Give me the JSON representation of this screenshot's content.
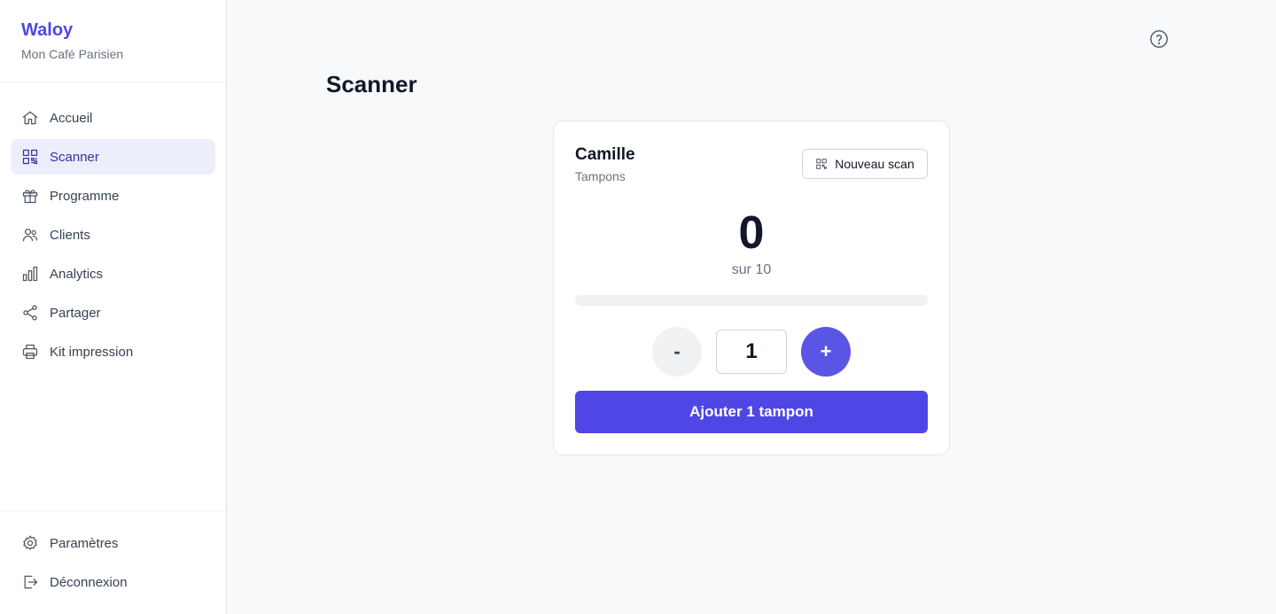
{
  "brand": {
    "name": "Waloy",
    "subtitle": "Mon Café Parisien"
  },
  "nav": {
    "items": [
      {
        "label": "Accueil",
        "icon": "home-icon"
      },
      {
        "label": "Scanner",
        "icon": "qr-code-icon",
        "active": true
      },
      {
        "label": "Programme",
        "icon": "gift-icon"
      },
      {
        "label": "Clients",
        "icon": "users-icon"
      },
      {
        "label": "Analytics",
        "icon": "bar-chart-icon"
      },
      {
        "label": "Partager",
        "icon": "share-icon"
      },
      {
        "label": "Kit impression",
        "icon": "printer-icon"
      }
    ],
    "bottom": [
      {
        "label": "Paramètres",
        "icon": "gear-icon"
      },
      {
        "label": "Déconnexion",
        "icon": "logout-icon"
      }
    ]
  },
  "header": {
    "help_icon": "help-circle-icon"
  },
  "page": {
    "title": "Scanner"
  },
  "card": {
    "customer_name": "Camille",
    "customer_sub": "Tampons",
    "new_scan_label": "Nouveau scan",
    "count": "0",
    "count_sub": "sur 10",
    "progress": 0,
    "minus_label": "-",
    "plus_label": "+",
    "quantity": "1",
    "add_label": "Ajouter 1 tampon"
  },
  "colors": {
    "accent": "#4f46e5",
    "active_bg": "#eceefb"
  }
}
